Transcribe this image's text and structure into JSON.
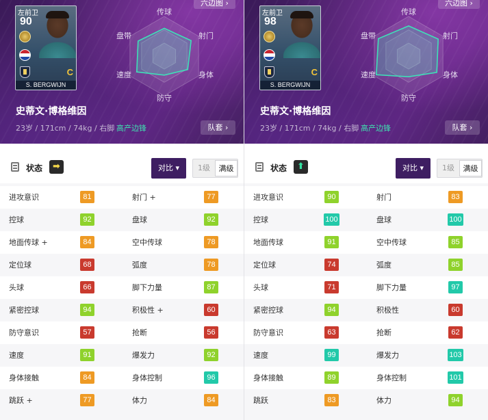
{
  "colors": {
    "orange": "#ee9a24",
    "lime": "#8fd22c",
    "red": "#c93a2e",
    "teal": "#22c9a9",
    "hero_bg": "#4f2270",
    "compare_btn": "#3e1e62",
    "playstyle": "#3fe0b0"
  },
  "panels": [
    {
      "hexmap_label": "六边图 ›",
      "card": {
        "position": "左前卫",
        "overall": "90",
        "grade": "C",
        "name": "S. BERGWIJN",
        "flag_icon": "netherlands-flag-icon"
      },
      "player": {
        "name": "史蒂文·博格维因",
        "info": "23岁 / 171cm / 74kg / 右脚",
        "playstyle": "高产边锋",
        "squad_label": "队套 ›"
      },
      "radar": {
        "labels": {
          "shooting": "射门",
          "passing": "传球",
          "dribbling": "盘带",
          "speed": "速度",
          "defense": "防守",
          "physical": "身体"
        },
        "values": {
          "shooting": 0.78,
          "passing": 0.7,
          "dribbling": 0.76,
          "speed": 0.8,
          "defense": 0.48,
          "physical": 0.68
        }
      },
      "toolbar": {
        "status_label": "状态",
        "condition_icon": "right-arrow-icon",
        "condition_glyph": "➡",
        "compare_label": "对比 ▾",
        "level1_label": "1级",
        "levelmax_label": "满级"
      },
      "stats": [
        {
          "left": {
            "name": "进攻意识",
            "value": "81",
            "color": "orange"
          },
          "right": {
            "name": "射门 +",
            "value": "77",
            "color": "orange"
          }
        },
        {
          "left": {
            "name": "控球",
            "value": "92",
            "color": "lime"
          },
          "right": {
            "name": "盘球",
            "value": "92",
            "color": "lime"
          }
        },
        {
          "left": {
            "name": "地面传球 +",
            "value": "84",
            "color": "orange"
          },
          "right": {
            "name": "空中传球",
            "value": "78",
            "color": "orange"
          }
        },
        {
          "left": {
            "name": "定位球",
            "value": "68",
            "color": "red"
          },
          "right": {
            "name": "弧度",
            "value": "78",
            "color": "orange"
          }
        },
        {
          "left": {
            "name": "头球",
            "value": "66",
            "color": "red"
          },
          "right": {
            "name": "脚下力量",
            "value": "87",
            "color": "lime"
          }
        },
        {
          "left": {
            "name": "紧密控球",
            "value": "94",
            "color": "lime"
          },
          "right": {
            "name": "积极性 +",
            "value": "60",
            "color": "red"
          }
        },
        {
          "left": {
            "name": "防守意识",
            "value": "57",
            "color": "red"
          },
          "right": {
            "name": "抢断",
            "value": "56",
            "color": "red"
          }
        },
        {
          "left": {
            "name": "速度",
            "value": "91",
            "color": "lime"
          },
          "right": {
            "name": "爆发力",
            "value": "92",
            "color": "lime"
          }
        },
        {
          "left": {
            "name": "身体接触",
            "value": "84",
            "color": "orange"
          },
          "right": {
            "name": "身体控制",
            "value": "96",
            "color": "teal"
          }
        },
        {
          "left": {
            "name": "跳跃 +",
            "value": "77",
            "color": "orange"
          },
          "right": {
            "name": "体力",
            "value": "84",
            "color": "orange"
          }
        }
      ]
    },
    {
      "hexmap_label": "六边图 ›",
      "card": {
        "position": "左前卫",
        "overall": "98",
        "grade": "C",
        "name": "S. BERGWIJN",
        "flag_icon": "netherlands-flag-icon"
      },
      "player": {
        "name": "史蒂文·博格维因",
        "info": "23岁 / 171cm / 74kg / 右脚",
        "playstyle": "高产边锋",
        "squad_label": "队套 ›"
      },
      "radar": {
        "labels": {
          "shooting": "射门",
          "passing": "传球",
          "dribbling": "盘带",
          "speed": "速度",
          "defense": "防守",
          "physical": "身体"
        },
        "values": {
          "shooting": 0.86,
          "passing": 0.76,
          "dribbling": 0.88,
          "speed": 0.94,
          "defense": 0.52,
          "physical": 0.82
        }
      },
      "toolbar": {
        "status_label": "状态",
        "condition_icon": "up-arrow-icon",
        "condition_glyph": "⬆",
        "compare_label": "对比 ▾",
        "level1_label": "1级",
        "levelmax_label": "满级"
      },
      "stats": [
        {
          "left": {
            "name": "进攻意识",
            "value": "90",
            "color": "lime"
          },
          "right": {
            "name": "射门",
            "value": "83",
            "color": "orange"
          }
        },
        {
          "left": {
            "name": "控球",
            "value": "100",
            "color": "teal"
          },
          "right": {
            "name": "盘球",
            "value": "100",
            "color": "teal"
          }
        },
        {
          "left": {
            "name": "地面传球",
            "value": "91",
            "color": "lime"
          },
          "right": {
            "name": "空中传球",
            "value": "85",
            "color": "lime"
          }
        },
        {
          "left": {
            "name": "定位球",
            "value": "74",
            "color": "red"
          },
          "right": {
            "name": "弧度",
            "value": "85",
            "color": "lime"
          }
        },
        {
          "left": {
            "name": "头球",
            "value": "71",
            "color": "red"
          },
          "right": {
            "name": "脚下力量",
            "value": "97",
            "color": "teal"
          }
        },
        {
          "left": {
            "name": "紧密控球",
            "value": "94",
            "color": "lime"
          },
          "right": {
            "name": "积极性",
            "value": "60",
            "color": "red"
          }
        },
        {
          "left": {
            "name": "防守意识",
            "value": "63",
            "color": "red"
          },
          "right": {
            "name": "抢断",
            "value": "62",
            "color": "red"
          }
        },
        {
          "left": {
            "name": "速度",
            "value": "99",
            "color": "teal"
          },
          "right": {
            "name": "爆发力",
            "value": "103",
            "color": "teal"
          }
        },
        {
          "left": {
            "name": "身体接触",
            "value": "89",
            "color": "lime"
          },
          "right": {
            "name": "身体控制",
            "value": "101",
            "color": "teal"
          }
        },
        {
          "left": {
            "name": "跳跃",
            "value": "83",
            "color": "orange"
          },
          "right": {
            "name": "体力",
            "value": "94",
            "color": "lime"
          }
        }
      ]
    }
  ]
}
